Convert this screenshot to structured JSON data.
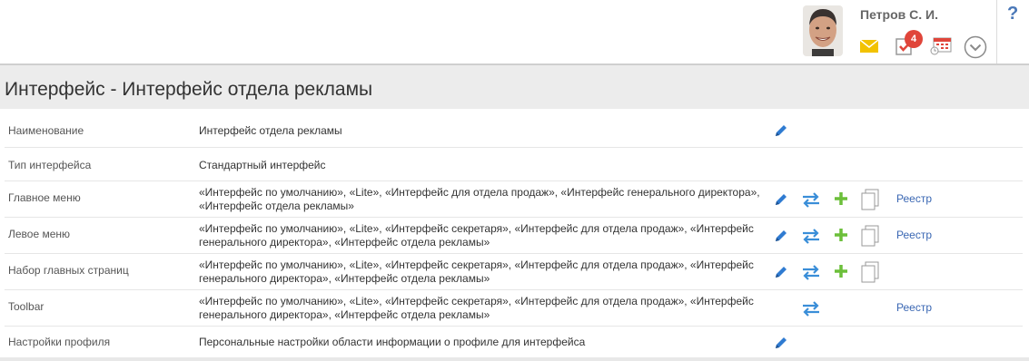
{
  "user": {
    "name": "Петров С. И.",
    "task_count": "4"
  },
  "help": {
    "label": "?"
  },
  "page": {
    "title": "Интерфейс - Интерфейс отдела рекламы"
  },
  "rows": [
    {
      "label": "Наименование",
      "value": "Интерфейс отдела рекламы"
    },
    {
      "label": "Тип интерфейса",
      "value": "Стандартный интерфейс"
    },
    {
      "label": "Главное меню",
      "value": "«Интерфейс по умолчанию», «Lite», «Интерфейс для отдела продаж», «Интерфейс генерального директора», «Интерфейс отдела рекламы»",
      "registry": "Реестр"
    },
    {
      "label": "Левое меню",
      "value": "«Интерфейс по умолчанию», «Lite», «Интерфейс секретаря», «Интерфейс для отдела продаж», «Интерфейс генерального директора», «Интерфейс отдела рекламы»",
      "registry": "Реестр"
    },
    {
      "label": "Набор главных страниц",
      "value": "«Интерфейс по умолчанию», «Lite», «Интерфейс секретаря», «Интерфейс для отдела продаж», «Интерфейс генерального директора», «Интерфейс отдела рекламы»"
    },
    {
      "label": "Toolbar",
      "value": "«Интерфейс по умолчанию», «Lite», «Интерфейс секретаря», «Интерфейс для отдела продаж», «Интерфейс генерального директора», «Интерфейс отдела рекламы»",
      "registry": "Реестр"
    },
    {
      "label": "Настройки профиля",
      "value": "Персональные настройки области информации о профиле для интерфейса"
    }
  ],
  "icons": {
    "mail": "mail-icon",
    "tasks": "tasks-icon",
    "calendar": "calendar-icon",
    "expand": "chevron-down-icon",
    "edit": "pencil-icon",
    "exchange": "exchange-icon",
    "add": "plus-icon",
    "copy": "copy-icon"
  },
  "colors": {
    "accent_blue": "#3a8ed8",
    "green": "#6cbf3a",
    "badge_red": "#e0453a",
    "mail_yellow": "#f2c200"
  }
}
